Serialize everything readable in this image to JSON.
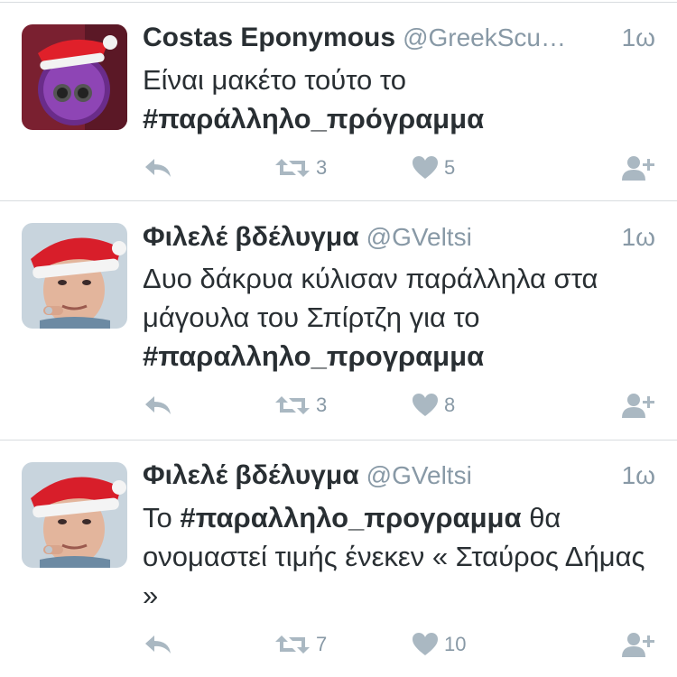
{
  "tweets": [
    {
      "name": "Costas Eponymous",
      "handle": "@GreekScu…",
      "time": "1ω",
      "text_before": "Είναι μακέτο τούτο το ",
      "hashtag": "#παράλληλο_πρόγραμμα",
      "text_after": "",
      "retweets": "3",
      "likes": "5",
      "avatar": "purple-minion-santa-hat"
    },
    {
      "name": "Φιλελέ βδέλυγμα",
      "handle": "@GVeltsi",
      "time": "1ω",
      "text_before": "Δυο δάκρυα κύλισαν παράλληλα στα μάγουλα του Σπίρτζη για το ",
      "hashtag": "#παραλληλο_προγραμμα",
      "text_after": "",
      "retweets": "3",
      "likes": "8",
      "avatar": "man-santa-hat"
    },
    {
      "name": "Φιλελέ βδέλυγμα",
      "handle": "@GVeltsi",
      "time": "1ω",
      "text_before": "Το ",
      "hashtag": "#παραλληλο_προγραμμα",
      "text_after": " θα ονομαστεί τιμής ένεκεν « Σταύρος Δήμας »",
      "retweets": "7",
      "likes": "10",
      "avatar": "man-santa-hat"
    }
  ],
  "colors": {
    "text": "#292f33",
    "muted": "#8899a6",
    "icon": "#aab8c2",
    "divider": "#d8dcdf"
  },
  "icons": [
    "reply-icon",
    "retweet-icon",
    "heart-icon",
    "follow-icon"
  ]
}
